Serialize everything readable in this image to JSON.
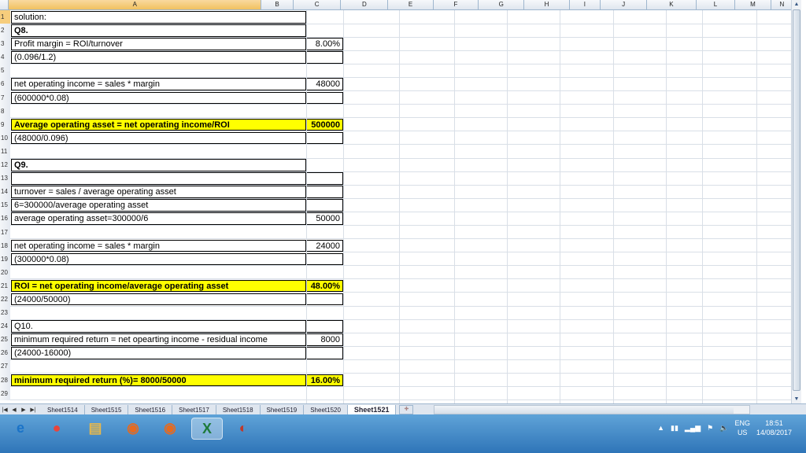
{
  "columns": [
    "A",
    "B",
    "C",
    "D",
    "E",
    "F",
    "G",
    "H",
    "I",
    "J",
    "K",
    "L",
    "M",
    "N"
  ],
  "rows": [
    {
      "n": "1",
      "a": "solution:",
      "b": "",
      "style": "box-a"
    },
    {
      "n": "2",
      "a": "Q8.",
      "b": "",
      "style": "bold"
    },
    {
      "n": "3",
      "a": "Profit margin = ROI/turnover",
      "b": "8.00%",
      "style": "box"
    },
    {
      "n": "4",
      "a": "(0.096/1.2)",
      "b": "",
      "style": "box"
    },
    {
      "n": "5",
      "a": "",
      "b": "",
      "style": "gap"
    },
    {
      "n": "6",
      "a": "net operating income = sales * margin",
      "b": "48000",
      "style": "box"
    },
    {
      "n": "7",
      "a": "(600000*0.08)",
      "b": "",
      "style": "box"
    },
    {
      "n": "8",
      "a": "",
      "b": "",
      "style": "gap"
    },
    {
      "n": "9",
      "a": "Average operating asset = net operating income/ROI",
      "b": "500000",
      "style": "hl"
    },
    {
      "n": "10",
      "a": "(48000/0.096)",
      "b": "",
      "style": "box"
    },
    {
      "n": "11",
      "a": "",
      "b": "",
      "style": "gap"
    },
    {
      "n": "12",
      "a": "Q9.",
      "b": "",
      "style": "bold"
    },
    {
      "n": "13",
      "a": "",
      "b": "",
      "style": "box"
    },
    {
      "n": "14",
      "a": "turnover = sales / average operating asset",
      "b": "",
      "style": "box"
    },
    {
      "n": "15",
      "a": "6=300000/average operating asset",
      "b": "",
      "style": "box"
    },
    {
      "n": "16",
      "a": "average operating asset=300000/6",
      "b": "50000",
      "style": "box"
    },
    {
      "n": "17",
      "a": "",
      "b": "",
      "style": "gap"
    },
    {
      "n": "18",
      "a": "net operating income = sales * margin",
      "b": "24000",
      "style": "box"
    },
    {
      "n": "19",
      "a": "(300000*0.08)",
      "b": "",
      "style": "box"
    },
    {
      "n": "20",
      "a": "",
      "b": "",
      "style": "gap"
    },
    {
      "n": "21",
      "a": "ROI = net operating income/average operating asset",
      "b": "48.00%",
      "style": "hl"
    },
    {
      "n": "22",
      "a": "(24000/50000)",
      "b": "",
      "style": "box"
    },
    {
      "n": "23",
      "a": "",
      "b": "",
      "style": "gap"
    },
    {
      "n": "24",
      "a": "Q10.",
      "b": "",
      "style": "box"
    },
    {
      "n": "25",
      "a": "minimum required return = net opearting income  -  residual income",
      "b": "8000",
      "style": "box"
    },
    {
      "n": "26",
      "a": "(24000-16000)",
      "b": "",
      "style": "box"
    },
    {
      "n": "27",
      "a": "",
      "b": "",
      "style": "gap"
    },
    {
      "n": "28",
      "a": "minimum required return (%)= 8000/50000",
      "b": "16.00%",
      "style": "hl"
    },
    {
      "n": "29",
      "a": "",
      "b": "",
      "style": "gap"
    }
  ],
  "sheet_tabs": [
    "Sheet1514",
    "Sheet1515",
    "Sheet1516",
    "Sheet1517",
    "Sheet1518",
    "Sheet1519",
    "Sheet1520",
    "Sheet1521"
  ],
  "active_tab": "Sheet1521",
  "taskbar": {
    "apps": [
      {
        "name": "internet-explorer-icon",
        "glyph": "e",
        "color": "#1a73c8"
      },
      {
        "name": "chrome-icon",
        "glyph": "●",
        "color": "#e8453c"
      },
      {
        "name": "file-explorer-icon",
        "glyph": "▤",
        "color": "#e8b84a"
      },
      {
        "name": "firefox-icon",
        "glyph": "◉",
        "color": "#e66a1f"
      },
      {
        "name": "firefox-2-icon",
        "glyph": "◉",
        "color": "#e66a1f"
      },
      {
        "name": "excel-icon",
        "glyph": "X",
        "color": "#1e7a3a"
      },
      {
        "name": "wpm-icon",
        "glyph": "◐",
        "color": "#c0392b"
      }
    ],
    "lang_top": "ENG",
    "lang_bottom": "US",
    "time": "18:51",
    "date": "14/08/2017"
  }
}
